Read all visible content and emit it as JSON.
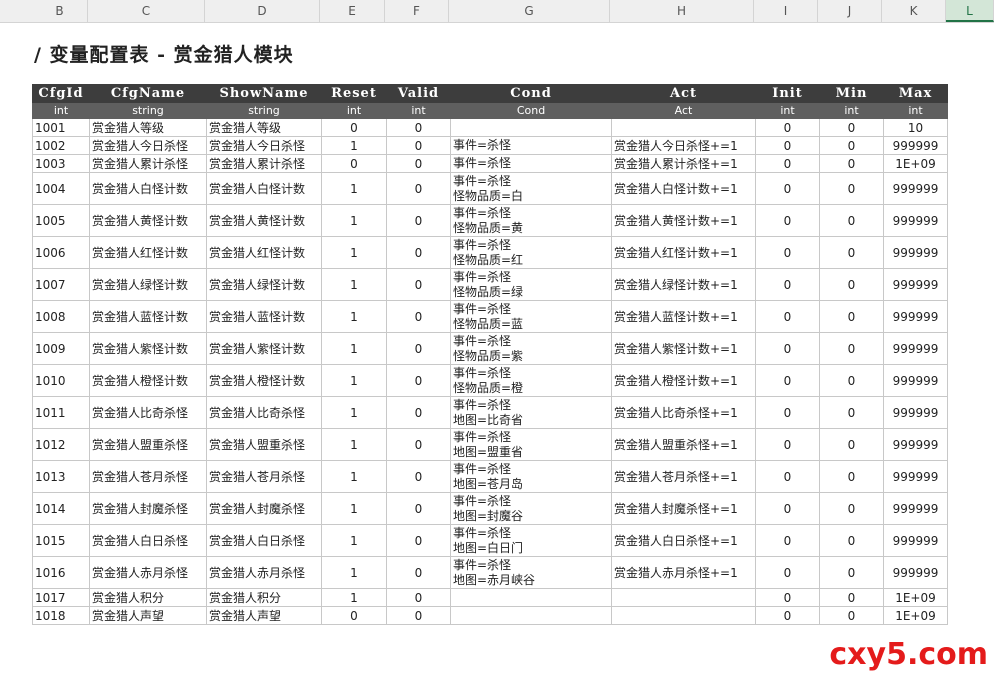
{
  "sheet": {
    "column_letters": [
      "B",
      "C",
      "D",
      "E",
      "F",
      "G",
      "H",
      "I",
      "J",
      "K",
      "L"
    ],
    "active_column": "L",
    "title": "/ 变量配置表 - 赏金猎人模块"
  },
  "table": {
    "headers": [
      "CfgId",
      "CfgName",
      "ShowName",
      "Reset",
      "Valid",
      "Cond",
      "Act",
      "Init",
      "Min",
      "Max"
    ],
    "types": [
      "int",
      "string",
      "string",
      "int",
      "int",
      "Cond",
      "Act",
      "int",
      "int",
      "int"
    ],
    "rows": [
      {
        "id": "1001",
        "name": "赏金猎人等级",
        "show": "赏金猎人等级",
        "reset": "0",
        "valid": "0",
        "cond": [],
        "act": "",
        "init": "0",
        "min": "0",
        "max": "10"
      },
      {
        "id": "1002",
        "name": "赏金猎人今日杀怪",
        "show": "赏金猎人今日杀怪",
        "reset": "1",
        "valid": "0",
        "cond": [
          "事件=杀怪"
        ],
        "act": "赏金猎人今日杀怪+=1",
        "init": "0",
        "min": "0",
        "max": "999999"
      },
      {
        "id": "1003",
        "name": "赏金猎人累计杀怪",
        "show": "赏金猎人累计杀怪",
        "reset": "0",
        "valid": "0",
        "cond": [
          "事件=杀怪"
        ],
        "act": "赏金猎人累计杀怪+=1",
        "init": "0",
        "min": "0",
        "max": "1E+09"
      },
      {
        "id": "1004",
        "name": "赏金猎人白怪计数",
        "show": "赏金猎人白怪计数",
        "reset": "1",
        "valid": "0",
        "cond": [
          "事件=杀怪",
          "怪物品质=白"
        ],
        "act": "赏金猎人白怪计数+=1",
        "init": "0",
        "min": "0",
        "max": "999999"
      },
      {
        "id": "1005",
        "name": "赏金猎人黄怪计数",
        "show": "赏金猎人黄怪计数",
        "reset": "1",
        "valid": "0",
        "cond": [
          "事件=杀怪",
          "怪物品质=黄"
        ],
        "act": "赏金猎人黄怪计数+=1",
        "init": "0",
        "min": "0",
        "max": "999999"
      },
      {
        "id": "1006",
        "name": "赏金猎人红怪计数",
        "show": "赏金猎人红怪计数",
        "reset": "1",
        "valid": "0",
        "cond": [
          "事件=杀怪",
          "怪物品质=红"
        ],
        "act": "赏金猎人红怪计数+=1",
        "init": "0",
        "min": "0",
        "max": "999999"
      },
      {
        "id": "1007",
        "name": "赏金猎人绿怪计数",
        "show": "赏金猎人绿怪计数",
        "reset": "1",
        "valid": "0",
        "cond": [
          "事件=杀怪",
          "怪物品质=绿"
        ],
        "act": "赏金猎人绿怪计数+=1",
        "init": "0",
        "min": "0",
        "max": "999999"
      },
      {
        "id": "1008",
        "name": "赏金猎人蓝怪计数",
        "show": "赏金猎人蓝怪计数",
        "reset": "1",
        "valid": "0",
        "cond": [
          "事件=杀怪",
          "怪物品质=蓝"
        ],
        "act": "赏金猎人蓝怪计数+=1",
        "init": "0",
        "min": "0",
        "max": "999999"
      },
      {
        "id": "1009",
        "name": "赏金猎人紫怪计数",
        "show": "赏金猎人紫怪计数",
        "reset": "1",
        "valid": "0",
        "cond": [
          "事件=杀怪",
          "怪物品质=紫"
        ],
        "act": "赏金猎人紫怪计数+=1",
        "init": "0",
        "min": "0",
        "max": "999999"
      },
      {
        "id": "1010",
        "name": "赏金猎人橙怪计数",
        "show": "赏金猎人橙怪计数",
        "reset": "1",
        "valid": "0",
        "cond": [
          "事件=杀怪",
          "怪物品质=橙"
        ],
        "act": "赏金猎人橙怪计数+=1",
        "init": "0",
        "min": "0",
        "max": "999999"
      },
      {
        "id": "1011",
        "name": "赏金猎人比奇杀怪",
        "show": "赏金猎人比奇杀怪",
        "reset": "1",
        "valid": "0",
        "cond": [
          "事件=杀怪",
          "地图=比奇省"
        ],
        "act": "赏金猎人比奇杀怪+=1",
        "init": "0",
        "min": "0",
        "max": "999999"
      },
      {
        "id": "1012",
        "name": "赏金猎人盟重杀怪",
        "show": "赏金猎人盟重杀怪",
        "reset": "1",
        "valid": "0",
        "cond": [
          "事件=杀怪",
          "地图=盟重省"
        ],
        "act": "赏金猎人盟重杀怪+=1",
        "init": "0",
        "min": "0",
        "max": "999999"
      },
      {
        "id": "1013",
        "name": "赏金猎人苍月杀怪",
        "show": "赏金猎人苍月杀怪",
        "reset": "1",
        "valid": "0",
        "cond": [
          "事件=杀怪",
          "地图=苍月岛"
        ],
        "act": "赏金猎人苍月杀怪+=1",
        "init": "0",
        "min": "0",
        "max": "999999"
      },
      {
        "id": "1014",
        "name": "赏金猎人封魔杀怪",
        "show": "赏金猎人封魔杀怪",
        "reset": "1",
        "valid": "0",
        "cond": [
          "事件=杀怪",
          "地图=封魔谷"
        ],
        "act": "赏金猎人封魔杀怪+=1",
        "init": "0",
        "min": "0",
        "max": "999999"
      },
      {
        "id": "1015",
        "name": "赏金猎人白日杀怪",
        "show": "赏金猎人白日杀怪",
        "reset": "1",
        "valid": "0",
        "cond": [
          "事件=杀怪",
          "地图=白日门"
        ],
        "act": "赏金猎人白日杀怪+=1",
        "init": "0",
        "min": "0",
        "max": "999999"
      },
      {
        "id": "1016",
        "name": "赏金猎人赤月杀怪",
        "show": "赏金猎人赤月杀怪",
        "reset": "1",
        "valid": "0",
        "cond": [
          "事件=杀怪",
          "地图=赤月峡谷"
        ],
        "act": "赏金猎人赤月杀怪+=1",
        "init": "0",
        "min": "0",
        "max": "999999"
      },
      {
        "id": "1017",
        "name": "赏金猎人积分",
        "show": "赏金猎人积分",
        "reset": "1",
        "valid": "0",
        "cond": [],
        "act": "",
        "init": "0",
        "min": "0",
        "max": "1E+09"
      },
      {
        "id": "1018",
        "name": "赏金猎人声望",
        "show": "赏金猎人声望",
        "reset": "0",
        "valid": "0",
        "cond": [],
        "act": "",
        "init": "0",
        "min": "0",
        "max": "1E+09"
      }
    ]
  },
  "watermark": "cxy5.com",
  "colors": {
    "header_bg": "#3d3d3d",
    "type_bg": "#5f5f5f",
    "watermark": "#e41b1b",
    "active_col": "#217346"
  }
}
